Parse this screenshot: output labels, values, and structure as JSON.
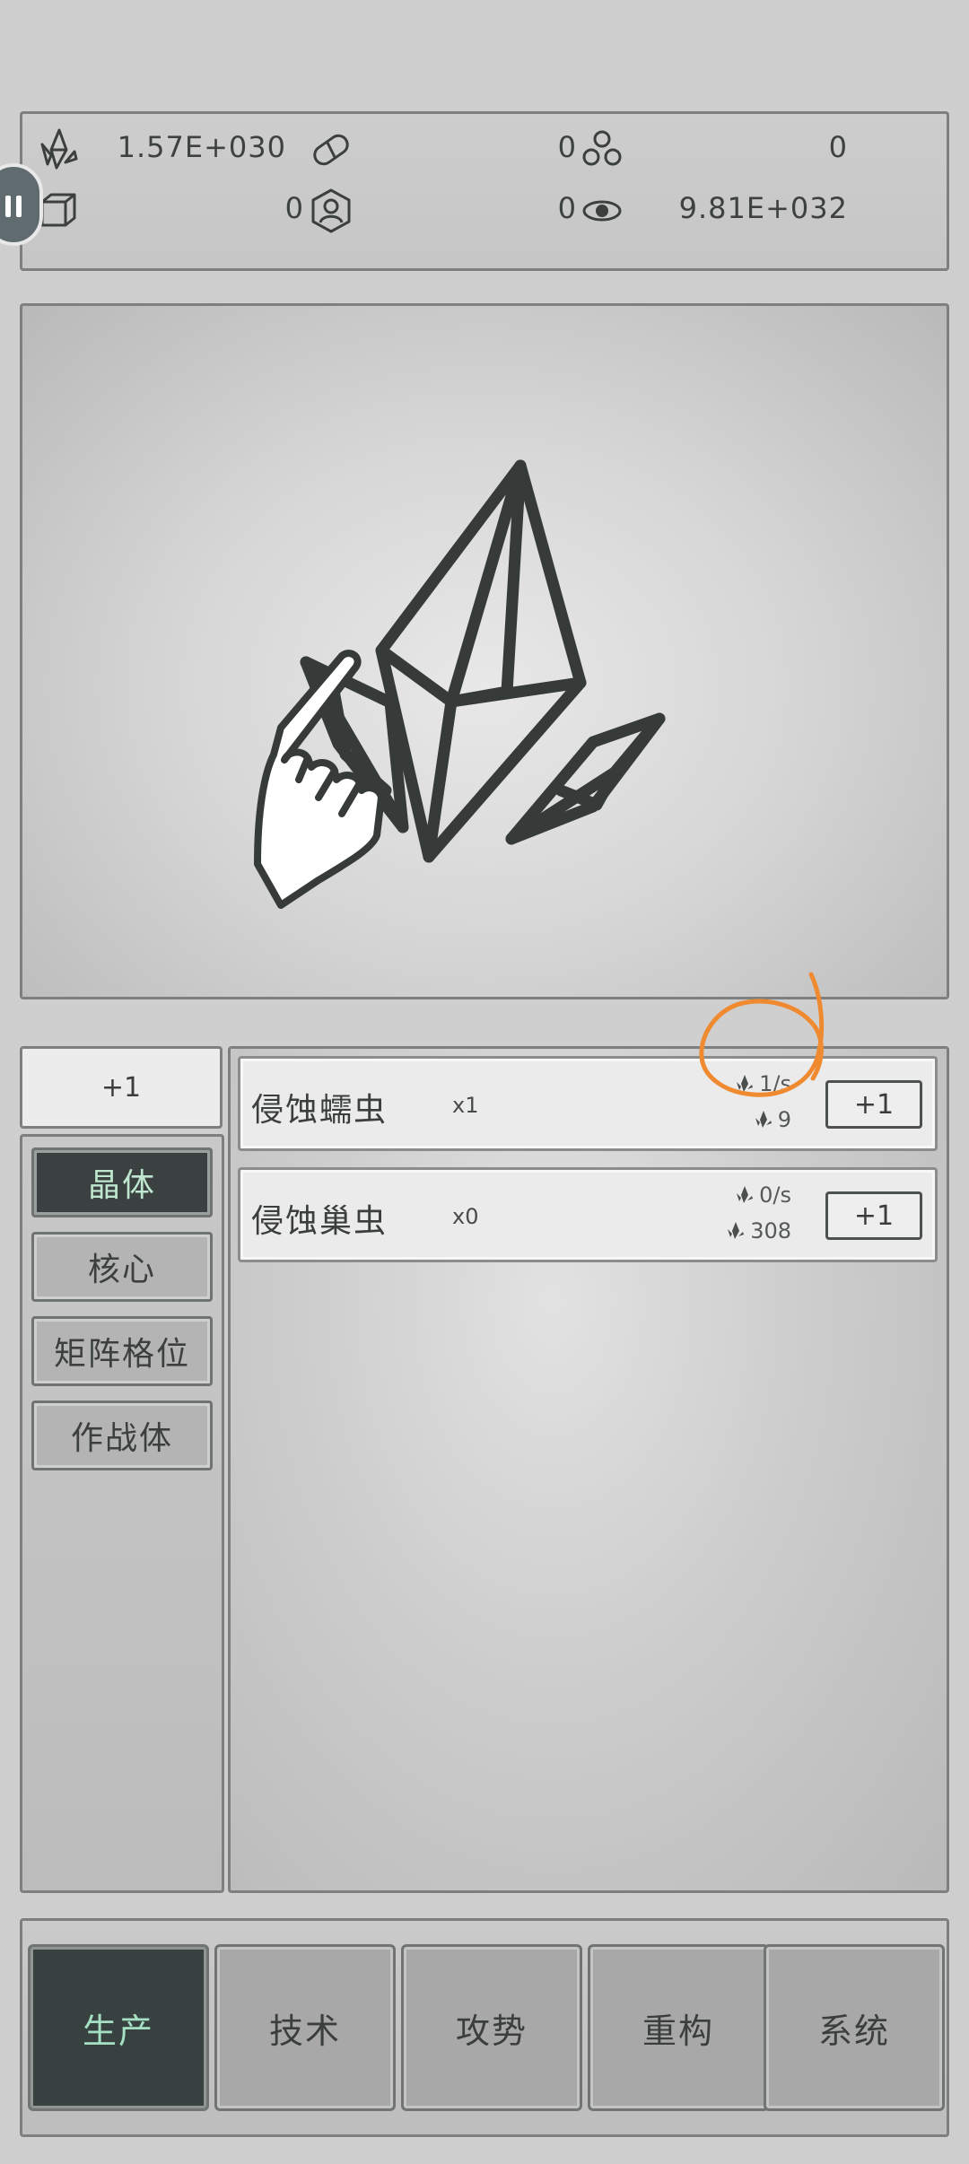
{
  "resources": [
    {
      "icon": "crystal-icon",
      "value": "1.57E+030"
    },
    {
      "icon": "pill-capsule-icon",
      "value": "0"
    },
    {
      "icon": "molecule-icon",
      "value": "0"
    },
    {
      "icon": "cube-icon",
      "value": "0"
    },
    {
      "icon": "person-badge-icon",
      "value": "0"
    },
    {
      "icon": "eye-orbit-icon",
      "value": "9.81E+032"
    }
  ],
  "buy_all_label": "+1",
  "categories": [
    {
      "label": "晶体",
      "active": true
    },
    {
      "label": "核心",
      "active": false
    },
    {
      "label": "矩阵格位",
      "active": false
    },
    {
      "label": "作战体",
      "active": false
    }
  ],
  "units": [
    {
      "name": "侵蚀蠕虫",
      "count": "x1",
      "rate": "1/s",
      "cost": "9",
      "button": "+1"
    },
    {
      "name": "侵蚀巢虫",
      "count": "x0",
      "rate": "0/s",
      "cost": "308",
      "button": "+1"
    }
  ],
  "nav": [
    {
      "label": "生产",
      "active": true
    },
    {
      "label": "技术",
      "active": false
    },
    {
      "label": "攻势",
      "active": false
    },
    {
      "label": "重构",
      "active": false
    },
    {
      "label": "系统",
      "active": false
    }
  ],
  "colors": {
    "accent_dark": "#364140",
    "accent_text": "#a6e0c3",
    "annotation": "#f08a30"
  }
}
